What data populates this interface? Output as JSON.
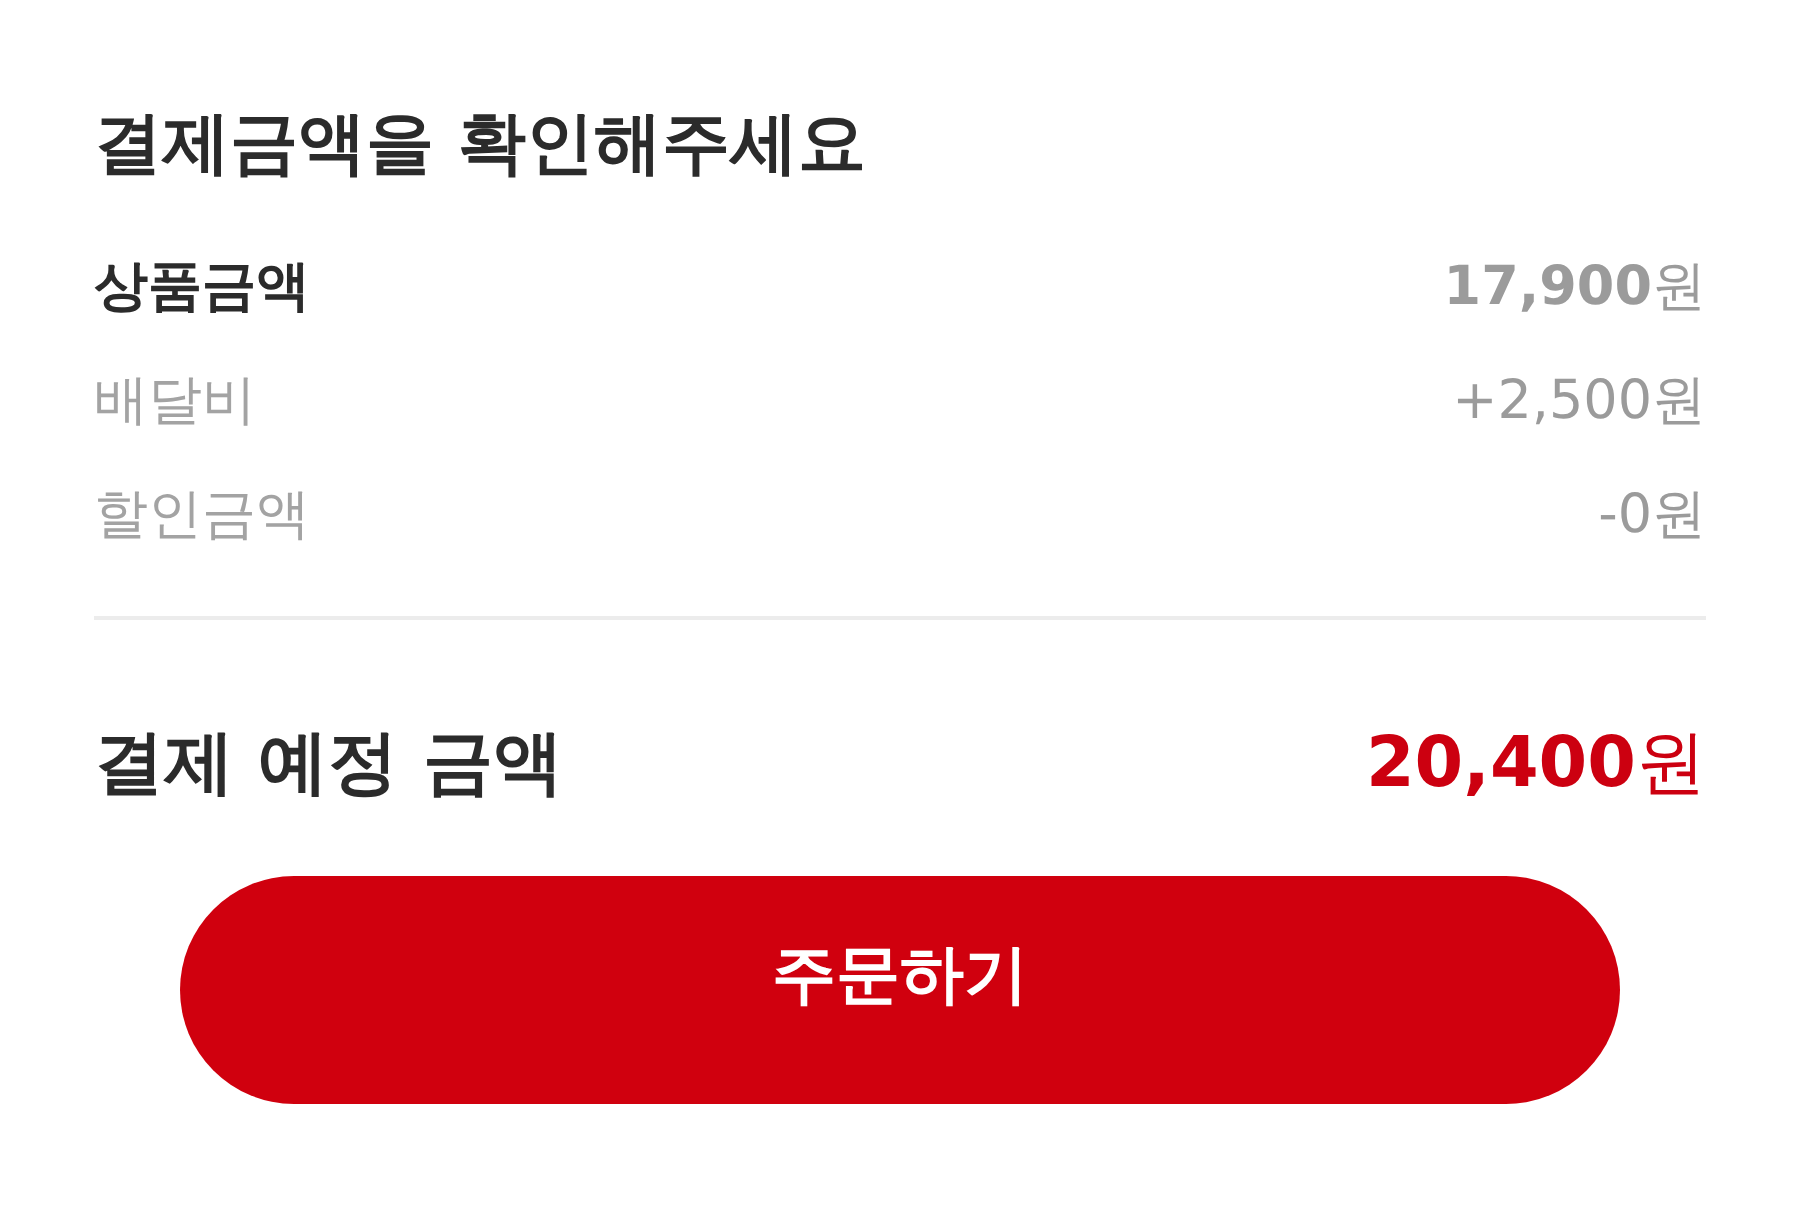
{
  "title": "결제금액을 확인해주세요",
  "items": [
    {
      "label": "상품금액",
      "amount": "**17,900**원",
      "emphasized": true
    },
    {
      "label": "배달비",
      "amount": "+2,500원",
      "emphasized": false
    },
    {
      "label": "할인금액",
      "amount": "-0원",
      "emphasized": false
    }
  ],
  "total": {
    "label": "결제 예정 금액",
    "amount": "**20,400**원"
  },
  "order_button": {
    "label": "주문하기"
  }
}
